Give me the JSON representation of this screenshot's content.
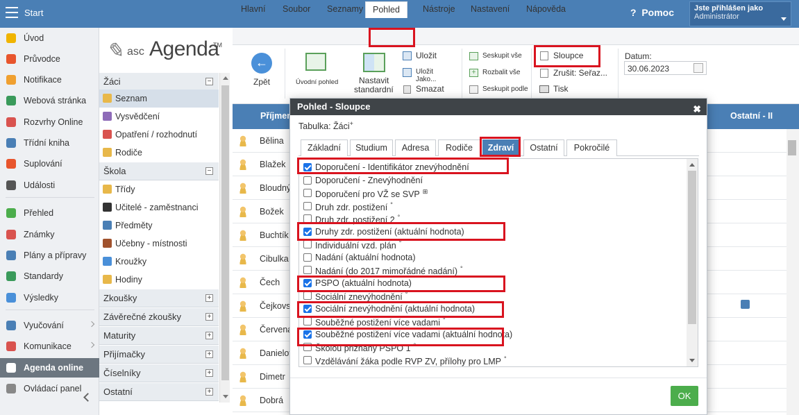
{
  "topbar": {
    "start_label": "Start",
    "help_label": "Pomoc",
    "user_line1": "Jste přihlášen jako",
    "user_line2": "Administrátor"
  },
  "leftnav": {
    "items": [
      {
        "label": "Úvod",
        "color": "#f0b400"
      },
      {
        "label": "Průvodce",
        "color": "#e8552d"
      },
      {
        "label": "Notifikace",
        "color": "#f0a030"
      },
      {
        "label": "Webová stránka",
        "color": "#3a9a5b"
      },
      {
        "label": "Rozvrhy Online",
        "color": "#d9534f"
      },
      {
        "label": "Třídní kniha",
        "color": "#4a7fb5"
      },
      {
        "label": "Suplování",
        "color": "#e8552d"
      },
      {
        "label": "Události",
        "color": "#555555"
      },
      {
        "label": "Přehled",
        "color": "#4cad4c"
      },
      {
        "label": "Známky",
        "color": "#d9534f"
      },
      {
        "label": "Plány a přípravy",
        "color": "#4a7fb5"
      },
      {
        "label": "Standardy",
        "color": "#3a9a5b"
      },
      {
        "label": "Výsledky",
        "color": "#4a90d9"
      },
      {
        "label": "Vyučování",
        "color": "#4a7fb5"
      },
      {
        "label": "Komunikace",
        "color": "#d9534f"
      },
      {
        "label": "Agenda online",
        "color": "#ffffff"
      },
      {
        "label": "Ovládací panel",
        "color": "#888888"
      }
    ]
  },
  "secnav": {
    "groups": [
      {
        "label": "Žáci",
        "sign": "−"
      },
      {
        "label": "Škola",
        "sign": "−"
      },
      {
        "label": "Zkoušky",
        "sign": "+"
      },
      {
        "label": "Závěrečné zkoušky",
        "sign": "+"
      },
      {
        "label": "Maturity",
        "sign": "+"
      },
      {
        "label": "Přijímačky",
        "sign": "+"
      },
      {
        "label": "Číselníky",
        "sign": "+"
      },
      {
        "label": "Ostatní",
        "sign": "+"
      }
    ],
    "items": [
      {
        "label": "Seznam",
        "color": "#e8b84a"
      },
      {
        "label": "Vysvědčení",
        "color": "#8e6bb8"
      },
      {
        "label": "Opatření / rozhodnutí",
        "color": "#d9534f"
      },
      {
        "label": "Rodiče",
        "color": "#e8b84a"
      },
      {
        "label": "Třídy",
        "color": "#e8b84a"
      },
      {
        "label": "Učitelé - zaměstnanci",
        "color": "#333333"
      },
      {
        "label": "Předměty",
        "color": "#4a7fb5"
      },
      {
        "label": "Učebny - místnosti",
        "color": "#a0522d"
      },
      {
        "label": "Kroužky",
        "color": "#4a90d9"
      },
      {
        "label": "Hodiny",
        "color": "#e8b84a"
      }
    ]
  },
  "menubar": {
    "items": [
      "Hlavní",
      "Soubor",
      "Seznamy",
      "Pohled",
      "Nástroje",
      "Nastavení",
      "Nápověda"
    ],
    "active": "Pohled"
  },
  "toolbar": {
    "back": "Zpět",
    "home_view": "Úvodní pohled",
    "standard_line1": "Nastavit",
    "standard_line2": "standardní",
    "save": "Uložit",
    "save_as": "Uložit Jako...",
    "delete": "Smazat",
    "group_all": "Seskupit vše",
    "expand_all": "Rozbalit vše",
    "group_by": "Seskupit podle",
    "columns": "Sloupce",
    "cancel_sort": "Zrušit: Seřaz...",
    "print": "Tisk",
    "date_label": "Datum:",
    "date_value": "30.06.2023"
  },
  "grid": {
    "col_surname": "Příjmení",
    "col_other": "Ostatní - II",
    "rows": [
      "Bělina",
      "Blažek",
      "Bloudný",
      "Božek",
      "Buchtík",
      "Cibulka",
      "Čech",
      "Čejkovs",
      "Červená",
      "Danielov",
      "Dimetr",
      "Dobrá"
    ]
  },
  "dialog": {
    "title": "Pohled - Sloupce",
    "table_label": "Tabulka: Žáci",
    "tabs": [
      "Základní",
      "Studium",
      "Adresa",
      "Rodiče",
      "Zdraví",
      "Ostatní",
      "Pokročilé"
    ],
    "active_tab": "Zdraví",
    "ok_label": "OK",
    "options": [
      {
        "label": "Doporučení - Identifikátor znevýhodnění",
        "checked": true
      },
      {
        "label": "Doporučení - Znevýhodnění",
        "checked": false
      },
      {
        "label": "Doporučení pro VŽ se SVP",
        "checked": false,
        "suffix": "⊞"
      },
      {
        "label": "Druh zdr. postižení",
        "checked": false,
        "suffix": "°"
      },
      {
        "label": "Druh zdr. postižení 2",
        "checked": false,
        "suffix": "°"
      },
      {
        "label": "Druhy zdr. postižení (aktuální hodnota)",
        "checked": true
      },
      {
        "label": "Individuální vzd. plán",
        "checked": false,
        "suffix": "°"
      },
      {
        "label": "Nadání (aktuální hodnota)",
        "checked": false
      },
      {
        "label": "Nadání (do 2017 mimořádné nadání)",
        "checked": false,
        "suffix": "°"
      },
      {
        "label": "PSPO (aktuální hodnota)",
        "checked": true
      },
      {
        "label": "Sociální znevýhodnění",
        "checked": false,
        "suffix": "°"
      },
      {
        "label": "Sociální znevýhodnění (aktuální hodnota)",
        "checked": true
      },
      {
        "label": "Souběžné postižení více vadami",
        "checked": false,
        "suffix": "°"
      },
      {
        "label": "Souběžné postižení více vadami (aktuální hodnota)",
        "checked": true
      },
      {
        "label": "Školou přiznaný PSPO 1",
        "checked": false,
        "suffix": "°"
      },
      {
        "label": "Vzdělávání žáka podle RVP ZV, přílohy pro LMP",
        "checked": false,
        "suffix": "°"
      }
    ]
  }
}
